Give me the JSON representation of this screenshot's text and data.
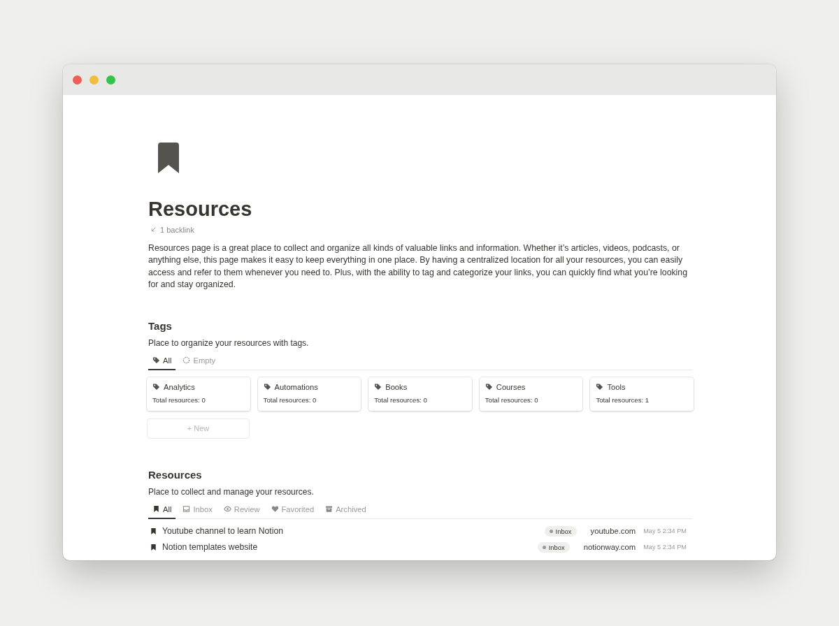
{
  "page": {
    "title": "Resources",
    "backlink": "1 backlink",
    "description": "Resources page is a great place to collect and organize all kinds of valuable links and information. Whether it’s articles, videos, podcasts, or anything else, this page makes it easy to keep everything in one place. By having a centralized location for all your resources, you can easily access and refer to them whenever you need to. Plus, with the ability to tag and categorize your links, you can quickly find what you’re looking for and stay organized."
  },
  "tags_section": {
    "heading": "Tags",
    "subtitle": "Place to organize your resources with tags.",
    "tabs": [
      {
        "label": "All",
        "kind": "tag",
        "selected": true
      },
      {
        "label": "Empty",
        "kind": "circle",
        "selected": false
      }
    ],
    "cards": [
      {
        "name": "Analytics",
        "count": "Total resources: 0"
      },
      {
        "name": "Automations",
        "count": "Total resources: 0"
      },
      {
        "name": "Books",
        "count": "Total resources: 0"
      },
      {
        "name": "Courses",
        "count": "Total resources: 0"
      },
      {
        "name": "Tools",
        "count": "Total resources: 1"
      }
    ],
    "new_button": "+ New"
  },
  "resources_section": {
    "heading": "Resources",
    "subtitle": "Place to collect and manage your resources.",
    "tabs": [
      {
        "label": "All",
        "kind": "bookmark",
        "selected": true
      },
      {
        "label": "Inbox",
        "kind": "inbox",
        "selected": false
      },
      {
        "label": "Review",
        "kind": "eye",
        "selected": false
      },
      {
        "label": "Favorited",
        "kind": "heart",
        "selected": false
      },
      {
        "label": "Archived",
        "kind": "archive",
        "selected": false
      }
    ],
    "rows": [
      {
        "title": "Youtube channel to learn Notion",
        "status": "Inbox",
        "domain": "youtube.com",
        "date": "May 5 2:34 PM"
      },
      {
        "title": "Notion templates website",
        "status": "Inbox",
        "domain": "notionway.com",
        "date": "May 5 2:34 PM"
      }
    ]
  }
}
